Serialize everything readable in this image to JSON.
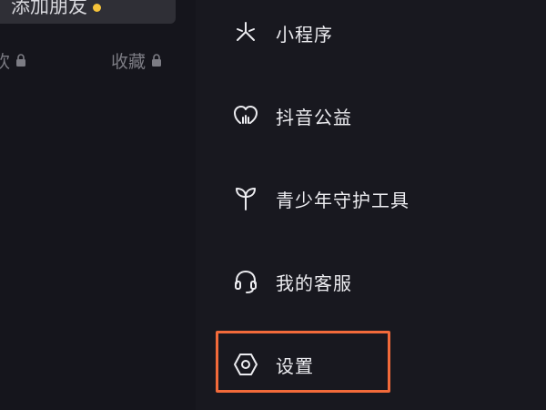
{
  "header": {
    "add_friend_label": "添加朋友",
    "notify_dot_color": "#f5c33a"
  },
  "profile_tabs": {
    "likes_label": "欢",
    "favorites_label": "收藏"
  },
  "menu": {
    "items": [
      {
        "label": "小程序",
        "icon": "mini-program-icon"
      },
      {
        "label": "抖音公益",
        "icon": "charity-heart-icon"
      },
      {
        "label": "青少年守护工具",
        "icon": "sprout-icon"
      },
      {
        "label": "我的客服",
        "icon": "headset-icon"
      },
      {
        "label": "设置",
        "icon": "settings-hex-icon"
      }
    ]
  },
  "colors": {
    "background": "#18181f",
    "highlight": "#f26a3a",
    "text": "#ececf0"
  }
}
